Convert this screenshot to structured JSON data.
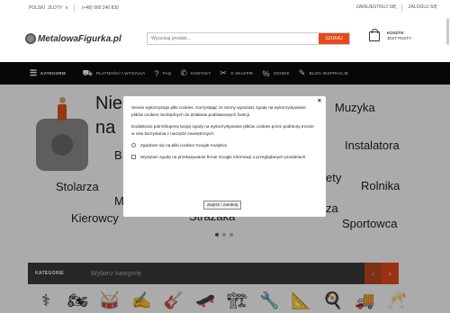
{
  "topbar": {
    "language": "POLSKI",
    "currency": "ZŁOTY",
    "chevron": "∨",
    "phone": "(+48) 900 240 830",
    "register": "ZAREJESTRUJ SIĘ",
    "login": "ZALOGUJ SIĘ"
  },
  "header": {
    "logo": "MetalowaFigurka.pl",
    "search_placeholder": "Wyszukaj produkt...",
    "search_button": "SZUKAJ",
    "cart_title": "KOSZYK",
    "cart_status": "JEST PUSTY"
  },
  "nav": {
    "items": [
      {
        "label": "KATEGORIE",
        "icon": "☰"
      },
      {
        "label": "PŁATNOŚCI I WYSYŁKA",
        "icon": "⛟"
      },
      {
        "label": "FAQ",
        "icon": "?"
      },
      {
        "label": "KONTAKT",
        "icon": "✆"
      },
      {
        "label": "O SKLEPIE",
        "icon": "✂"
      },
      {
        "label": "CENNIK",
        "icon": "%"
      },
      {
        "label": "BLOG-INSPIRACJE",
        "icon": "✎"
      }
    ]
  },
  "hero": {
    "words": [
      "Nie",
      "na",
      "Muzyka",
      "Instalatora",
      "B",
      "Stolarza",
      "Rolnika",
      "M",
      "ety",
      "Kierowcy",
      "Strażaka",
      "za",
      "Sportowca"
    ]
  },
  "modal": {
    "close": "×",
    "text1": "Serwis wykorzystuje pliki cookies. Korzystając ze strony wyrażasz zgodę na wykorzystywanie plików cookies niezbędnych do działania podstawowych funkcji.",
    "text2": "Dodatkowo potrzebujemy twojej zgody na wykorzystywanie plików cookies przez podmioty trzecie w celu korzystania z narzędzi zewnętrznych:",
    "option1": "Zgadzam się na pliki cookies Google Analytics",
    "option2": "Wyrażam zgodę na przekazywanie firmie Google informacji o przeglądanych produktach",
    "button": "Zapisz i zamknij"
  },
  "categories": {
    "label": "KATEGORIE",
    "placeholder": "Wybierz kategorię",
    "prev": "‹",
    "next": "›",
    "icons": [
      "doctor-icon",
      "motorcycle-icon",
      "drums-icon",
      "teacher-icon",
      "guitar-icon",
      "skateboard-icon",
      "forklift-icon",
      "tools-icon",
      "drawing-icon",
      "cooking-icon",
      "delivery-truck-icon",
      "toast-icon"
    ],
    "glyphs": [
      "⚕",
      "🏍",
      "🥁",
      "✍",
      "🎸",
      "🛹",
      "🏗",
      "🔧",
      "📐",
      "🍳",
      "🚚",
      "🥂"
    ]
  },
  "colors": {
    "accent": "#e74a1a",
    "nav_bg": "#0b0b0b",
    "category_bar_bg": "#3b3b3b"
  }
}
